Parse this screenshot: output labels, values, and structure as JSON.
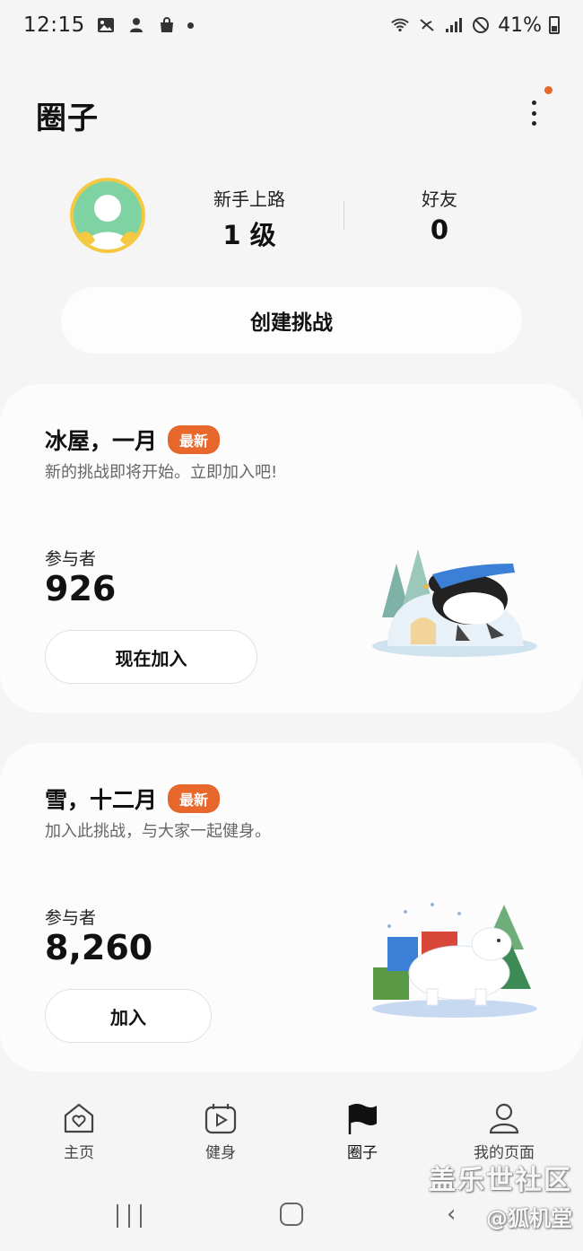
{
  "status_bar": {
    "time": "12:15",
    "battery": "41%",
    "icons_left": [
      "gallery-icon",
      "assistant-icon",
      "shopping-bag-icon",
      "dot-icon"
    ],
    "icons_right": [
      "wifi-icon",
      "no-signal-call-icon",
      "signal-icon",
      "do-not-disturb-icon",
      "battery-icon"
    ]
  },
  "header": {
    "title": "圈子",
    "notification_color": "#e8672a"
  },
  "profile": {
    "level_label": "新手上路",
    "level_value": "1 级",
    "friends_label": "好友",
    "friends_value": "0"
  },
  "create_challenge_label": "创建挑战",
  "challenges": [
    {
      "title": "冰屋，一月",
      "badge": "最新",
      "subtitle": "新的挑战即将开始。立即加入吧!",
      "participants_label": "参与者",
      "participants": "926",
      "button_label": "现在加入"
    },
    {
      "title": "雪，十二月",
      "badge": "最新",
      "subtitle": "加入此挑战，与大家一起健身。",
      "participants_label": "参与者",
      "participants": "8,260",
      "button_label": "加入"
    }
  ],
  "bottom_nav": {
    "home": "主页",
    "fitness": "健身",
    "circle": "圈子",
    "my_page": "我的页面"
  },
  "watermark": {
    "main": "盖乐世社区",
    "sub": "@狐机堂"
  },
  "colors": {
    "accent": "#e8672a",
    "background": "#f5f5f5",
    "card": "#fcfcfc"
  }
}
